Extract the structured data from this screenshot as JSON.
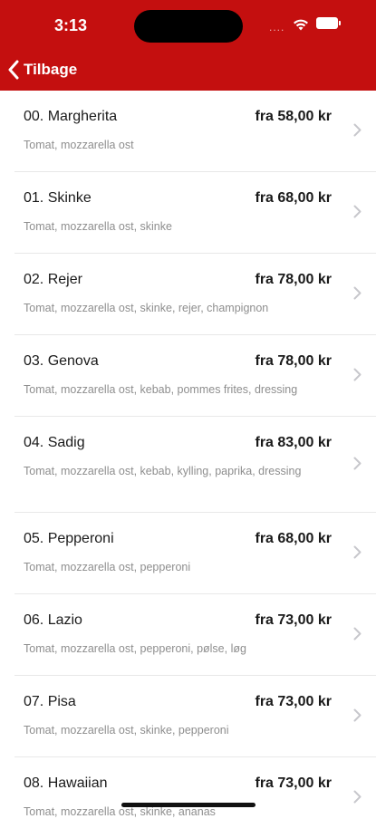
{
  "status": {
    "time": "3:13",
    "dots": "...."
  },
  "nav": {
    "back_label": "Tilbage"
  },
  "colors": {
    "header": "#c40f0f",
    "description": "#8e8e8e",
    "chevron": "#c7c7cc"
  },
  "items": [
    {
      "name": "00. Margherita",
      "price": "fra 58,00 kr",
      "description": "Tomat, mozzarella ost"
    },
    {
      "name": "01. Skinke",
      "price": "fra 68,00 kr",
      "description": "Tomat, mozzarella ost, skinke"
    },
    {
      "name": "02. Rejer",
      "price": "fra 78,00 kr",
      "description": "Tomat, mozzarella ost, skinke, rejer, champignon"
    },
    {
      "name": "03. Genova",
      "price": "fra 78,00 kr",
      "description": "Tomat, mozzarella ost, kebab, pommes frites, dressing"
    },
    {
      "name": "04. Sadig",
      "price": "fra 83,00 kr",
      "description": "Tomat, mozzarella ost, kebab, kylling, paprika, dressing"
    },
    {
      "name": "05. Pepperoni",
      "price": "fra 68,00 kr",
      "description": "Tomat, mozzarella ost, pepperoni"
    },
    {
      "name": "06. Lazio",
      "price": "fra 73,00 kr",
      "description": "Tomat, mozzarella ost, pepperoni, pølse, løg"
    },
    {
      "name": "07. Pisa",
      "price": "fra 73,00 kr",
      "description": "Tomat, mozzarella ost, skinke, pepperoni"
    },
    {
      "name": "08. Hawaiian",
      "price": "fra 73,00 kr",
      "description": "Tomat, mozzarella ost, skinke, ananas"
    }
  ]
}
